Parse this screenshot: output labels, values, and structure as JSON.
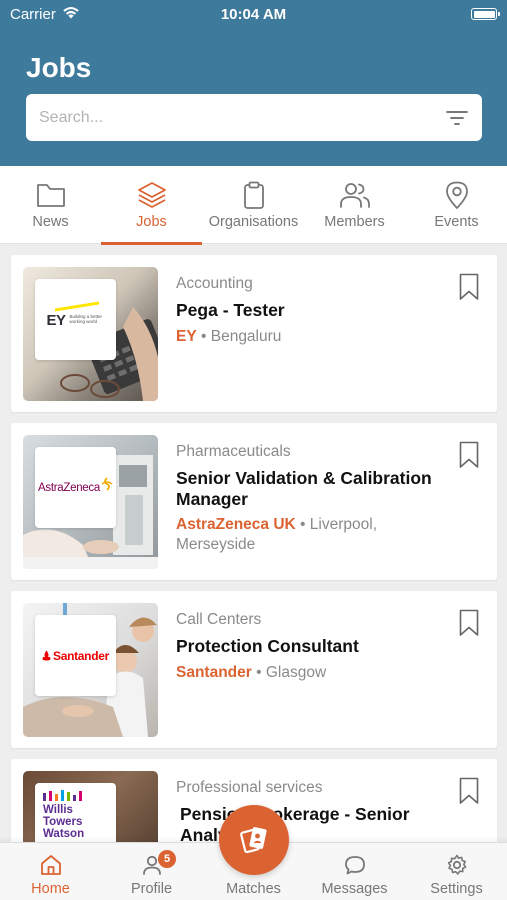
{
  "status_bar": {
    "carrier": "Carrier",
    "time": "10:04 AM"
  },
  "header": {
    "title": "Jobs"
  },
  "search": {
    "placeholder": "Search..."
  },
  "tabs": [
    {
      "label": "News",
      "icon": "folder-icon",
      "active": false
    },
    {
      "label": "Jobs",
      "icon": "layers-icon",
      "active": true
    },
    {
      "label": "Organisations",
      "icon": "clipboard-icon",
      "active": false
    },
    {
      "label": "Members",
      "icon": "users-icon",
      "active": false
    },
    {
      "label": "Events",
      "icon": "map-pin-icon",
      "active": false
    }
  ],
  "jobs": [
    {
      "category": "Accounting",
      "title_lines": [
        "Pega - Tester"
      ],
      "company": "EY",
      "location": "Bengaluru",
      "logo_text": "EY",
      "logo_tagline": "Building a better working world"
    },
    {
      "category": "Pharmaceuticals",
      "title_lines": [
        "Senior Validation & Calibration",
        "Manager"
      ],
      "company": "AstraZeneca UK",
      "location": "Liverpool,",
      "location_line2": "Merseyside",
      "logo_text": "AstraZeneca"
    },
    {
      "category": "Call Centers",
      "title_lines": [
        "Protection Consultant"
      ],
      "company": "Santander",
      "location": "Glasgow",
      "logo_text": "Santander"
    },
    {
      "category": "Professional services",
      "title_lines": [
        "Pension Brokerage - Senior",
        "Analyst"
      ],
      "logo_text_lines": [
        "Willis",
        "Towers",
        "Watson"
      ]
    }
  ],
  "bottom_nav": [
    {
      "label": "Home",
      "icon": "home-icon",
      "active": true
    },
    {
      "label": "Profile",
      "icon": "user-icon",
      "badge": "5"
    },
    {
      "label": "Matches",
      "icon": "cards-icon"
    },
    {
      "label": "Messages",
      "icon": "chat-bubble-icon"
    },
    {
      "label": "Settings",
      "icon": "gear-icon"
    }
  ],
  "colors": {
    "header": "#3e7a9b",
    "accent": "#db6332",
    "muted": "#8a8a8a"
  }
}
